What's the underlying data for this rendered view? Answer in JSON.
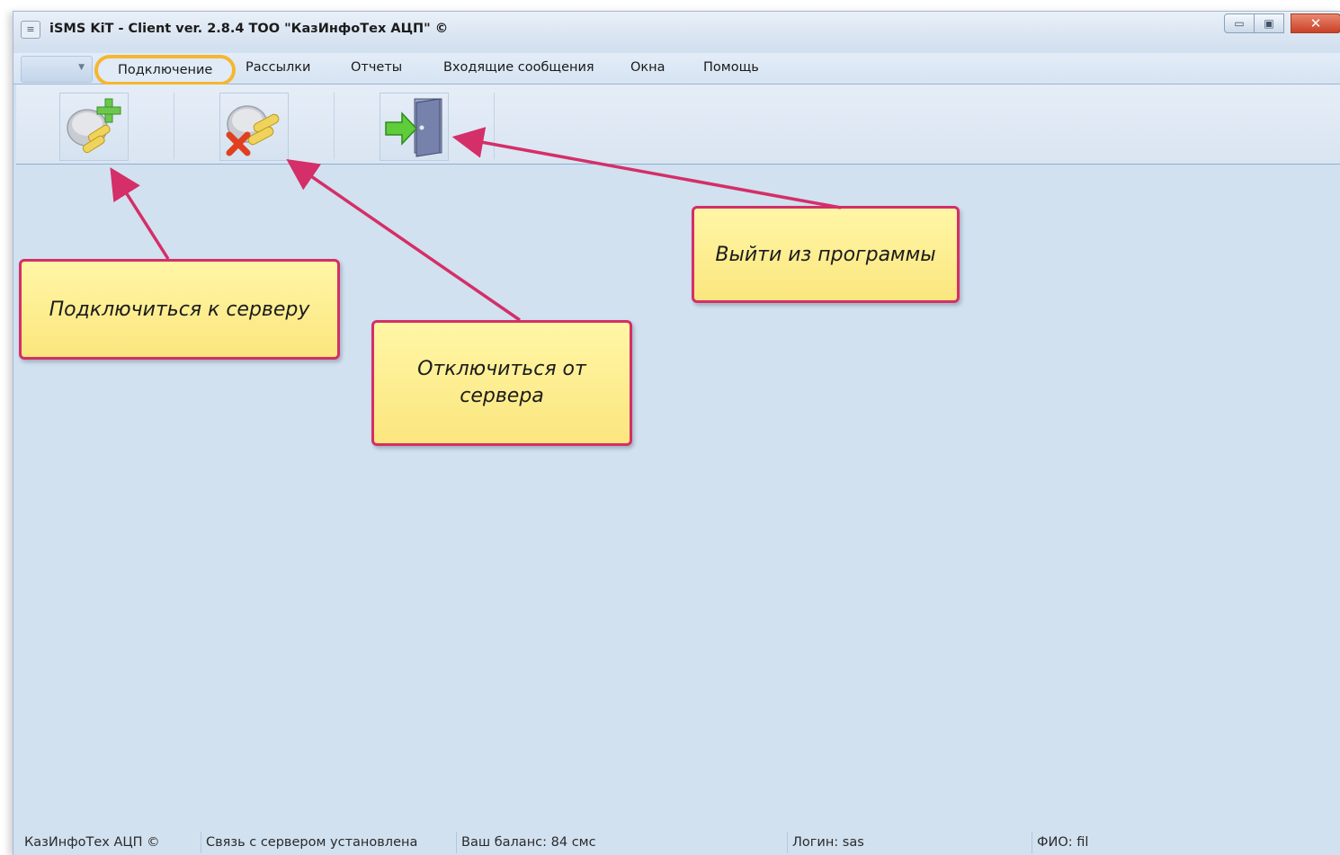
{
  "window": {
    "title": "iSMS KiT - Client ver. 2.8.4 ТОО \"КазИнфоТех АЦП\" ©",
    "controls": {
      "minimize": "▭",
      "maximize": "▣",
      "close": "✕"
    }
  },
  "menu": {
    "items": [
      "Подключение",
      "Рассылки",
      "Отчеты",
      "Входящие сообщения",
      "Окна",
      "Помощь"
    ],
    "active": "Подключение"
  },
  "toolbar": {
    "buttons": [
      {
        "name": "connect",
        "icon": "plug-add-icon"
      },
      {
        "name": "disconnect",
        "icon": "plug-remove-icon"
      },
      {
        "name": "exit",
        "icon": "exit-door-icon"
      }
    ]
  },
  "callouts": {
    "connect": "Подключиться к серверу",
    "disconnect_line1": "Отключиться от",
    "disconnect_line2": "сервера",
    "exit": "Выйти из программы"
  },
  "statusbar": {
    "company": "КазИнфоТех АЦП ©",
    "connection": "Связь с сервером установлена",
    "balance": "Ваш баланс: 84 смс",
    "login": "Логин: sas",
    "fio": "ФИО: fil"
  },
  "colors": {
    "callout_border": "#d42f68",
    "callout_fill": "#fbe67e",
    "highlight_ring": "#f5b731",
    "arrow": "#d42f68",
    "workspace": "#d1e1f0"
  }
}
